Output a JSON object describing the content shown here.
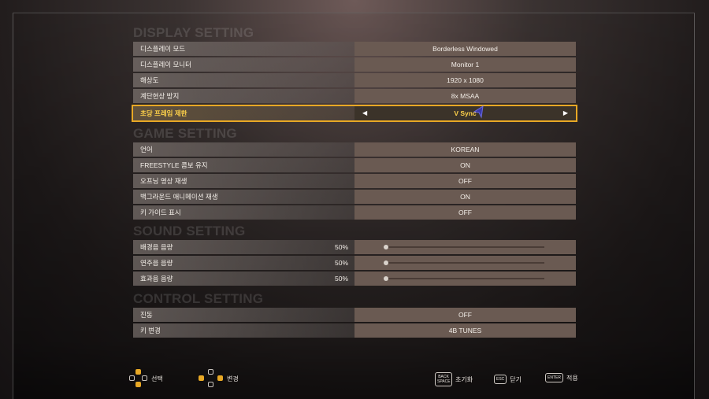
{
  "sections": {
    "display": {
      "title": "DISPLAY SETTING",
      "rows": [
        {
          "label": "디스플레이 모드",
          "value": "Borderless Windowed"
        },
        {
          "label": "디스플레이 모니터",
          "value": "Monitor 1"
        },
        {
          "label": "해상도",
          "value": "1920 x 1080"
        },
        {
          "label": "계단현상 방지",
          "value": "8x MSAA"
        }
      ],
      "selected": {
        "label": "초당 프레임 제한",
        "value": "V Sync"
      }
    },
    "game": {
      "title": "GAME SETTING",
      "rows": [
        {
          "label": "언어",
          "value": "KOREAN"
        },
        {
          "label": "FREESTYLE 콤보 유지",
          "value": "ON"
        },
        {
          "label": "오프닝 영상 재생",
          "value": "OFF"
        },
        {
          "label": "백그라운드 애니메이션 재생",
          "value": "ON"
        },
        {
          "label": "키 가이드 표시",
          "value": "OFF"
        }
      ]
    },
    "sound": {
      "title": "SOUND SETTING",
      "rows": [
        {
          "label": "배경음 음량",
          "percent": "50%",
          "level": 0
        },
        {
          "label": "연주음 음량",
          "percent": "50%",
          "level": 0
        },
        {
          "label": "효과음 음량",
          "percent": "50%",
          "level": 0
        }
      ]
    },
    "control": {
      "title": "CONTROL SETTING",
      "rows": [
        {
          "label": "진동",
          "value": "OFF"
        },
        {
          "label": "키 변경",
          "value": "4B TUNES"
        }
      ]
    }
  },
  "icons": {
    "arrow_left": "◀",
    "arrow_right": "▶"
  },
  "footer": {
    "select_label": "선택",
    "change_label": "변경",
    "reset_key": "BACK SPACE",
    "reset_label": "초기화",
    "close_key": "ESC",
    "close_label": "닫기",
    "apply_key": "ENTER",
    "apply_label": "적용"
  },
  "colors": {
    "accent": "#e8a825",
    "selected_text": "#ffd24a"
  }
}
